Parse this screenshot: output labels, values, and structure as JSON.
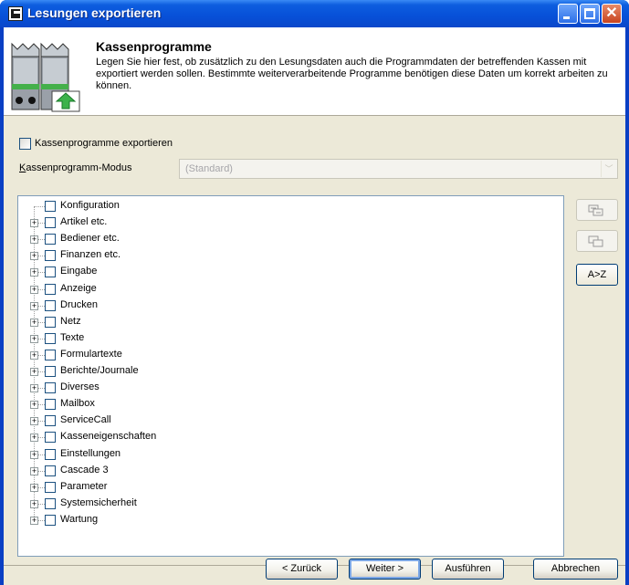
{
  "window": {
    "title": "Lesungen exportieren"
  },
  "header": {
    "title": "Kassenprogramme",
    "description": "Legen Sie hier fest, ob zusätzlich zu den Lesungsdaten auch die Programmdaten der betreffenden Kassen mit exportiert werden sollen. Bestimmte weiterverarbeitende Programme benötigen diese Daten um korrekt arbeiten zu können.",
    "icon": "register-export-icon"
  },
  "export_checkbox": {
    "label": "Kassenprogramme exportieren",
    "checked": false
  },
  "mode": {
    "label": "Kassenprogramm-Modus",
    "value": "(Standard)"
  },
  "tree": {
    "items": [
      {
        "label": "Konfiguration",
        "expandable": false
      },
      {
        "label": "Artikel etc.",
        "expandable": true
      },
      {
        "label": "Bediener etc.",
        "expandable": true
      },
      {
        "label": "Finanzen etc.",
        "expandable": true
      },
      {
        "label": "Eingabe",
        "expandable": true
      },
      {
        "label": "Anzeige",
        "expandable": true
      },
      {
        "label": "Drucken",
        "expandable": true
      },
      {
        "label": "Netz",
        "expandable": true
      },
      {
        "label": "Texte",
        "expandable": true
      },
      {
        "label": "Formulartexte",
        "expandable": true
      },
      {
        "label": "Berichte/Journale",
        "expandable": true
      },
      {
        "label": "Diverses",
        "expandable": true
      },
      {
        "label": "Mailbox",
        "expandable": true
      },
      {
        "label": "ServiceCall",
        "expandable": true
      },
      {
        "label": "Kasseneigenschaften",
        "expandable": true
      },
      {
        "label": "Einstellungen",
        "expandable": true
      },
      {
        "label": "Cascade 3",
        "expandable": true
      },
      {
        "label": "Parameter",
        "expandable": true
      },
      {
        "label": "Systemsicherheit",
        "expandable": true
      },
      {
        "label": "Wartung",
        "expandable": true
      }
    ]
  },
  "side_buttons": {
    "expand_all_icon": "expand-all-icon",
    "collapse_all_icon": "collapse-all-icon",
    "sort_label": "A>Z"
  },
  "buttons": {
    "back": "< Zurück",
    "next": "Weiter >",
    "execute": "Ausführen",
    "cancel": "Abbrechen"
  },
  "colors": {
    "title_bar": "#0a47c9",
    "dialog_bg": "#ece9d8"
  }
}
